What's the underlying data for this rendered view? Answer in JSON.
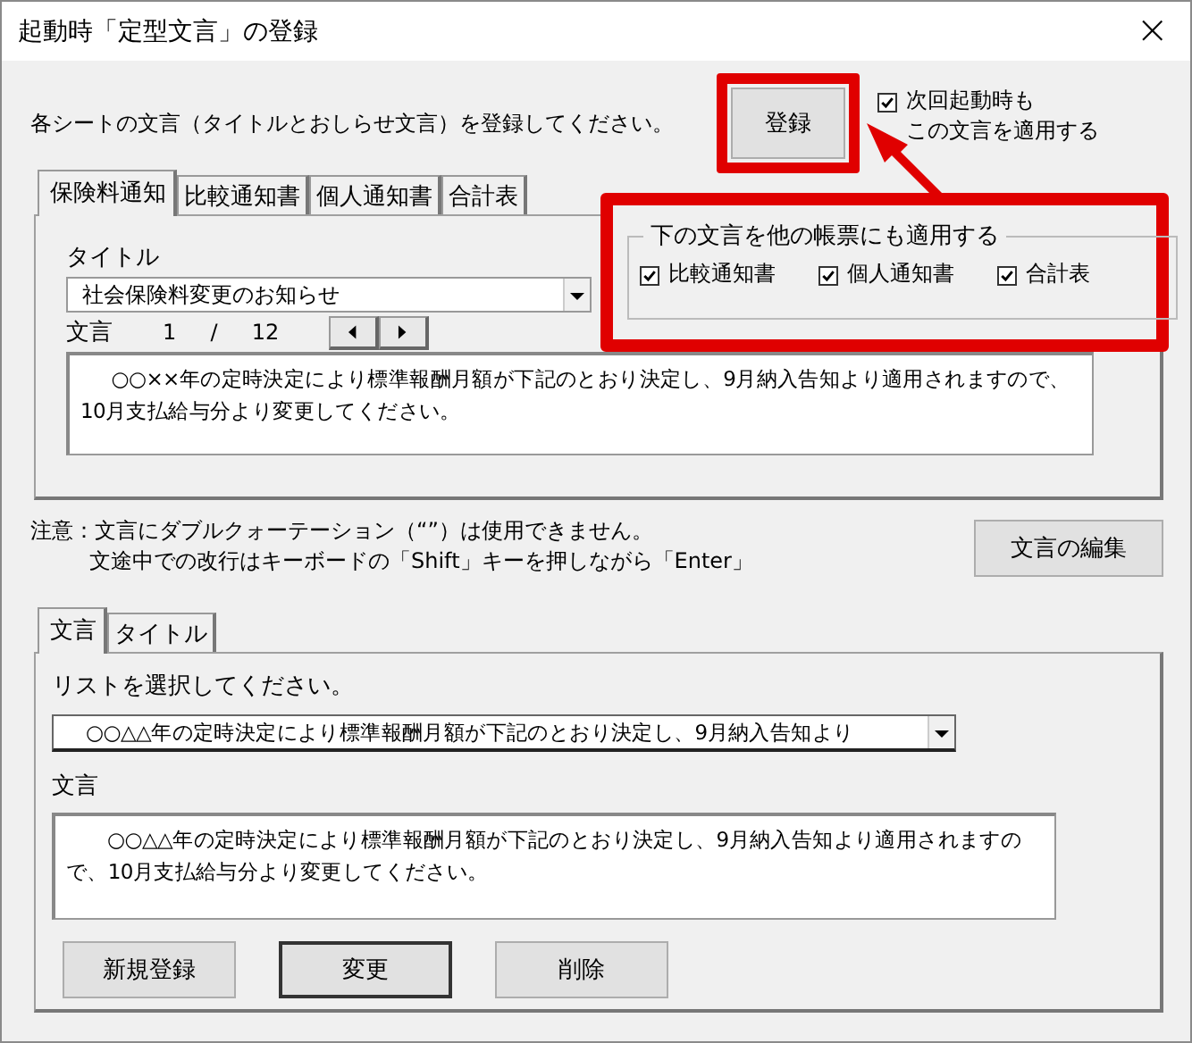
{
  "window": {
    "title": "起動時「定型文言」の登録",
    "close": "×"
  },
  "instruction": "各シートの文言（タイトルとおしらせ文言）を登録してください。",
  "register_button": "登録",
  "startup_checkbox": {
    "lines": [
      "次回起動時も",
      "この文言を適用する"
    ],
    "checked": true
  },
  "sheet_tabs": [
    {
      "label": "保険料通知",
      "selected": true
    },
    {
      "label": "比較通知書",
      "selected": false
    },
    {
      "label": "個人通知書",
      "selected": false
    },
    {
      "label": "合計表",
      "selected": false
    }
  ],
  "title_field": {
    "label": "タイトル",
    "value": "社会保険料変更のお知らせ"
  },
  "message_nav": {
    "label": "文言",
    "current": "1",
    "separator": "/",
    "total": "12"
  },
  "message_text": "○○××年の定時決定により標準報酬月額が下記のとおり決定し、9月納入告知より適用されますので、10月支払給与分より変更してください。",
  "apply_group": {
    "legend": "下の文言を他の帳票にも適用する",
    "options": [
      {
        "label": "比較通知書",
        "checked": true
      },
      {
        "label": "個人通知書",
        "checked": true
      },
      {
        "label": "合計表",
        "checked": true
      }
    ]
  },
  "notes": [
    "注意：文言にダブルクォーテーション（“”）は使用できません。",
    "文途中での改行はキーボードの「Shift」キーを押しながら「Enter」"
  ],
  "edit_button": "文言の編集",
  "edit_tabs": [
    {
      "label": "文言",
      "selected": true
    },
    {
      "label": "タイトル",
      "selected": false
    }
  ],
  "list_label": "リストを選択してください。",
  "list_value": "○○△△年の定時決定により標準報酬月額が下記のとおり決定し、9月納入告知より",
  "text_label": "文言",
  "text_value": "○○△△年の定時決定により標準報酬月額が下記のとおり決定し、9月納入告知より適用されますので、10月支払給与分より変更してください。",
  "buttons": [
    {
      "label": "新規登録",
      "default": false
    },
    {
      "label": "変更",
      "default": true
    },
    {
      "label": "削除",
      "default": false
    }
  ]
}
